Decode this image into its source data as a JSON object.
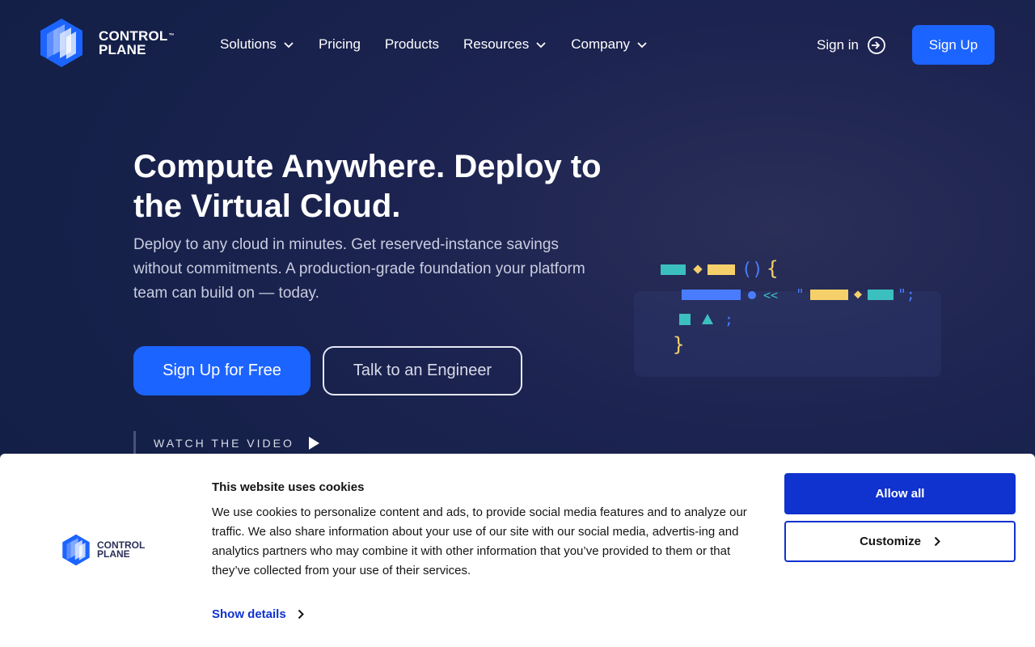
{
  "header": {
    "logo_line1": "CONTROL",
    "logo_tm": "™",
    "logo_line2": "PLANE",
    "nav": [
      {
        "label": "Solutions",
        "has_dropdown": true
      },
      {
        "label": "Pricing",
        "has_dropdown": false
      },
      {
        "label": "Products",
        "has_dropdown": false
      },
      {
        "label": "Resources",
        "has_dropdown": true
      },
      {
        "label": "Company",
        "has_dropdown": true
      }
    ],
    "sign_in": "Sign in",
    "sign_up": "Sign Up"
  },
  "hero": {
    "title": "Compute Anywhere. Deploy to the Virtual Cloud.",
    "subtitle": "Deploy to any cloud in minutes. Get reserved-instance savings without commitments. A production-grade foundation your platform team can build on — today.",
    "primary_cta": "Sign Up for Free",
    "secondary_cta": "Talk to an Engineer",
    "watch_video": "WATCH THE VIDEO"
  },
  "cookie_banner": {
    "logo_line1": "CONTROL",
    "logo_line2": "PLANE",
    "title": "This website uses cookies",
    "text": "We use cookies to personalize content and ads, to provide social media features and to analyze our traffic. We also share information about your use of our site with our social media, advertis-ing and analytics partners who may combine it with other information that you’ve provided to them or that they’ve collected from your use of their services.",
    "show_details": "Show details",
    "allow_all": "Allow all",
    "customize": "Customize"
  },
  "colors": {
    "accent": "#1c64ff",
    "cookie_accent": "#1032cf",
    "background": "#142048",
    "teal": "#3cbfbf",
    "yellow": "#f5d06a",
    "blue_bar": "#4a7cff"
  }
}
